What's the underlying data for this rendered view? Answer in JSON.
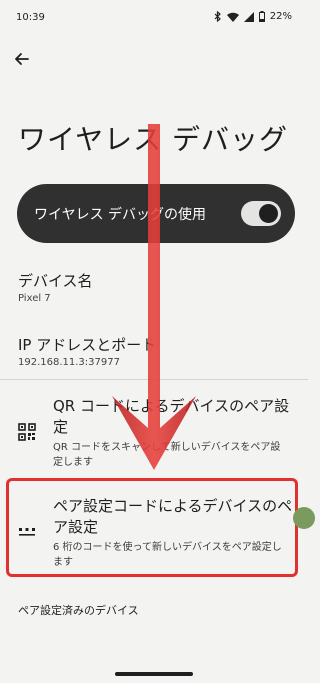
{
  "status_bar": {
    "time": "10:39",
    "battery": "22%",
    "icons": [
      "bluetooth-icon",
      "wifi-icon",
      "signal-icon",
      "battery-icon"
    ]
  },
  "header": {
    "back_icon": "arrow-back-icon",
    "title": "ワイヤレス デバッグ"
  },
  "main_switch": {
    "label": "ワイヤレス デバッグの使用",
    "enabled": true
  },
  "device_name": {
    "title": "デバイス名",
    "value": "Pixel 7"
  },
  "ip_port": {
    "title": "IP アドレスとポート",
    "value": "192.168.11.3:37977"
  },
  "menu": [
    {
      "icon": "qr-code-icon",
      "title": "QR コードによるデバイスのペア設定",
      "description": "QR コードをスキャンして新しいデバイスをペア設定します"
    },
    {
      "icon": "dialpad-icon",
      "title": "ペア設定コードによるデバイスのペア設定",
      "description": "6 桁のコードを使って新しいデバイスをペア設定します"
    }
  ],
  "paired_section": {
    "title": "ペア設定済みのデバイス"
  },
  "colors": {
    "background": "#f3f3f1",
    "switch_bg": "#303030",
    "annotation_red": "#e0312f"
  }
}
